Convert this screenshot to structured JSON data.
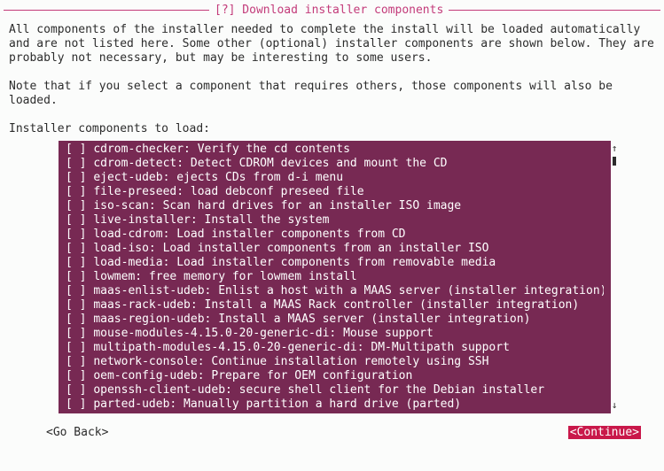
{
  "title": "[?] Download installer components",
  "para1": "All components of the installer needed to complete the install will be loaded automatically and are not listed here. Some other (optional) installer components are shown below. They are probably not necessary, but may be interesting to some users.",
  "para2": "Note that if you select a component that requires others, those components will also be loaded.",
  "prompt": "Installer components to load:",
  "items": [
    "cdrom-checker: Verify the cd contents",
    "cdrom-detect: Detect CDROM devices and mount the CD",
    "eject-udeb: ejects CDs from d-i menu",
    "file-preseed: load debconf preseed file",
    "iso-scan: Scan hard drives for an installer ISO image",
    "live-installer: Install the system",
    "load-cdrom: Load installer components from CD",
    "load-iso: Load installer components from an installer ISO",
    "load-media: Load installer components from removable media",
    "lowmem: free memory for lowmem install",
    "maas-enlist-udeb: Enlist a host with a MAAS server (installer integration)",
    "maas-rack-udeb: Install a MAAS Rack controller (installer integration)",
    "maas-region-udeb: Install a MAAS server (installer integration)",
    "mouse-modules-4.15.0-20-generic-di: Mouse support",
    "multipath-modules-4.15.0-20-generic-di: DM-Multipath support",
    "network-console: Continue installation remotely using SSH",
    "oem-config-udeb: Prepare for OEM configuration",
    "openssh-client-udeb: secure shell client for the Debian installer",
    "parted-udeb: Manually partition a hard drive (parted)"
  ],
  "checkbox_prefix": "[ ] ",
  "go_back": "<Go Back>",
  "continue": "<Continue>",
  "scroll": {
    "up": "↑",
    "down": "↓"
  }
}
